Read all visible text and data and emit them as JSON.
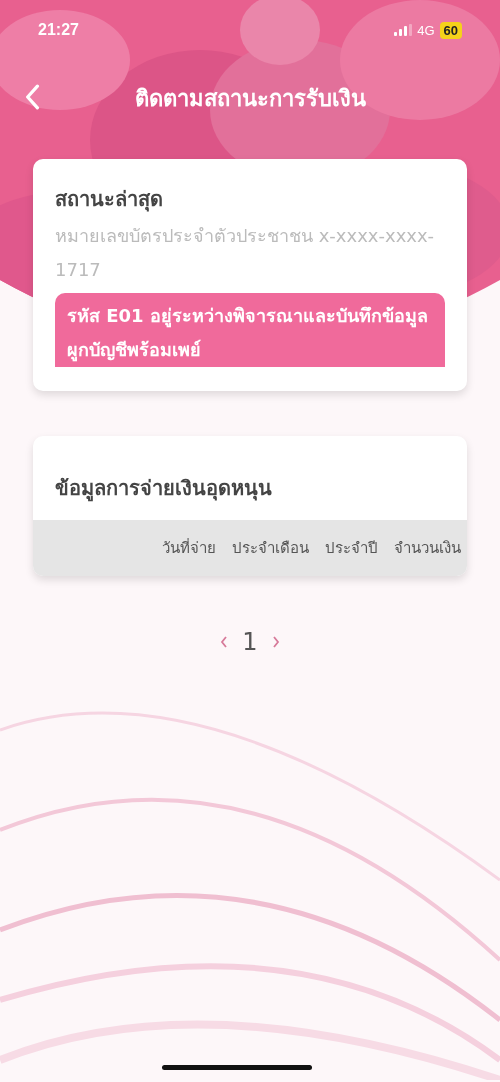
{
  "status_bar": {
    "time": "21:27",
    "network": "4G",
    "battery": "60"
  },
  "header": {
    "title": "ติดตามสถานะการรับเงิน"
  },
  "status_card": {
    "title": "สถานะล่าสุด",
    "id_text": "หมายเลขบัตรประจำตัวประชาชน x-xxxx-xxxx-1717",
    "message_lines": [
      "รหัส E01 อยู่ระหว่างพิจารณาและบันทึกข้อมูล",
      " ผูกบัญชีพร้อมเพย์"
    ]
  },
  "payment_card": {
    "title": "ข้อมูลการจ่ายเงินอุดหนุน",
    "table": {
      "columns": [
        "วันที่จ่าย",
        "ประจำเดือน",
        "ประจำปี",
        "จำนวนเงิน"
      ]
    }
  },
  "pagination": {
    "page": "1"
  }
}
